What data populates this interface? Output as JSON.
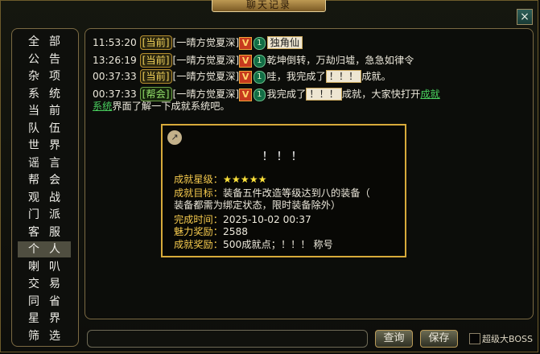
{
  "window": {
    "title": "聊天记录",
    "close_icon": "×"
  },
  "sidebar": {
    "items": [
      {
        "label": "全部",
        "c1": "全",
        "c2": "部"
      },
      {
        "label": "公告",
        "c1": "公",
        "c2": "告"
      },
      {
        "label": "杂项",
        "c1": "杂",
        "c2": "项"
      },
      {
        "label": "系统",
        "c1": "系",
        "c2": "统"
      },
      {
        "label": "当前",
        "c1": "当",
        "c2": "前"
      },
      {
        "label": "队伍",
        "c1": "队",
        "c2": "伍"
      },
      {
        "label": "世界",
        "c1": "世",
        "c2": "界"
      },
      {
        "label": "谣言",
        "c1": "谣",
        "c2": "言"
      },
      {
        "label": "帮会",
        "c1": "帮",
        "c2": "会"
      },
      {
        "label": "观战",
        "c1": "观",
        "c2": "战"
      },
      {
        "label": "门派",
        "c1": "门",
        "c2": "派"
      },
      {
        "label": "客服",
        "c1": "客",
        "c2": "服"
      },
      {
        "label": "个人",
        "c1": "个",
        "c2": "人"
      },
      {
        "label": "喇叭",
        "c1": "喇",
        "c2": "叭"
      },
      {
        "label": "交易",
        "c1": "交",
        "c2": "易"
      },
      {
        "label": "同省",
        "c1": "同",
        "c2": "省"
      },
      {
        "label": "星界",
        "c1": "星",
        "c2": "界"
      },
      {
        "label": "筛选",
        "c1": "筛",
        "c2": "选"
      }
    ],
    "active_index": 12
  },
  "messages": [
    {
      "time": "11:53:20",
      "channel": "[当前]",
      "player": "[一晴方觉夏深]",
      "vip": "V",
      "level": "1",
      "text": "",
      "item": "独角仙"
    },
    {
      "time": "13:26:19",
      "channel": "[当前]",
      "player": "[一晴方觉夏深]",
      "vip": "V",
      "level": "1",
      "text": "乾坤倒转，万劫归墟，急急如律令"
    },
    {
      "time": "00:37:33",
      "channel": "[当前]",
      "player": "[一晴方觉夏深]",
      "vip": "V",
      "level": "1",
      "text_before": "哇，我完成了",
      "item": "！！！",
      "text_after": "成就。"
    },
    {
      "time": "00:37:33",
      "channel": "[帮会]",
      "player": "[一晴方觉夏深]",
      "vip": "V",
      "level": "1",
      "text_before": "我完成了",
      "item": "！！！",
      "text_after": "成就，大家快打开",
      "link_part1": "成就",
      "link_part2": "系统",
      "text_end": "界面了解一下成就系统吧。"
    }
  ],
  "popup": {
    "share_icon": "↗",
    "title": "！！！",
    "rows": [
      {
        "label": "成就星级：",
        "value": "★★★★★"
      },
      {
        "label": "成就目标：",
        "value": "装备五件改造等级达到八的装备（"
      },
      {
        "label": "",
        "value": "装备都需为绑定状态，限时装备除外）"
      },
      {
        "label": "完成时间：",
        "value": "2025-10-02 00:37"
      },
      {
        "label": "魅力奖励：",
        "value": "2588"
      },
      {
        "label": "成就奖励：",
        "value": "500成就点；！！！ 称号"
      }
    ]
  },
  "footer": {
    "query_label": "查询",
    "save_label": "保存",
    "boss_label": "超级大BOSS",
    "input_value": ""
  }
}
